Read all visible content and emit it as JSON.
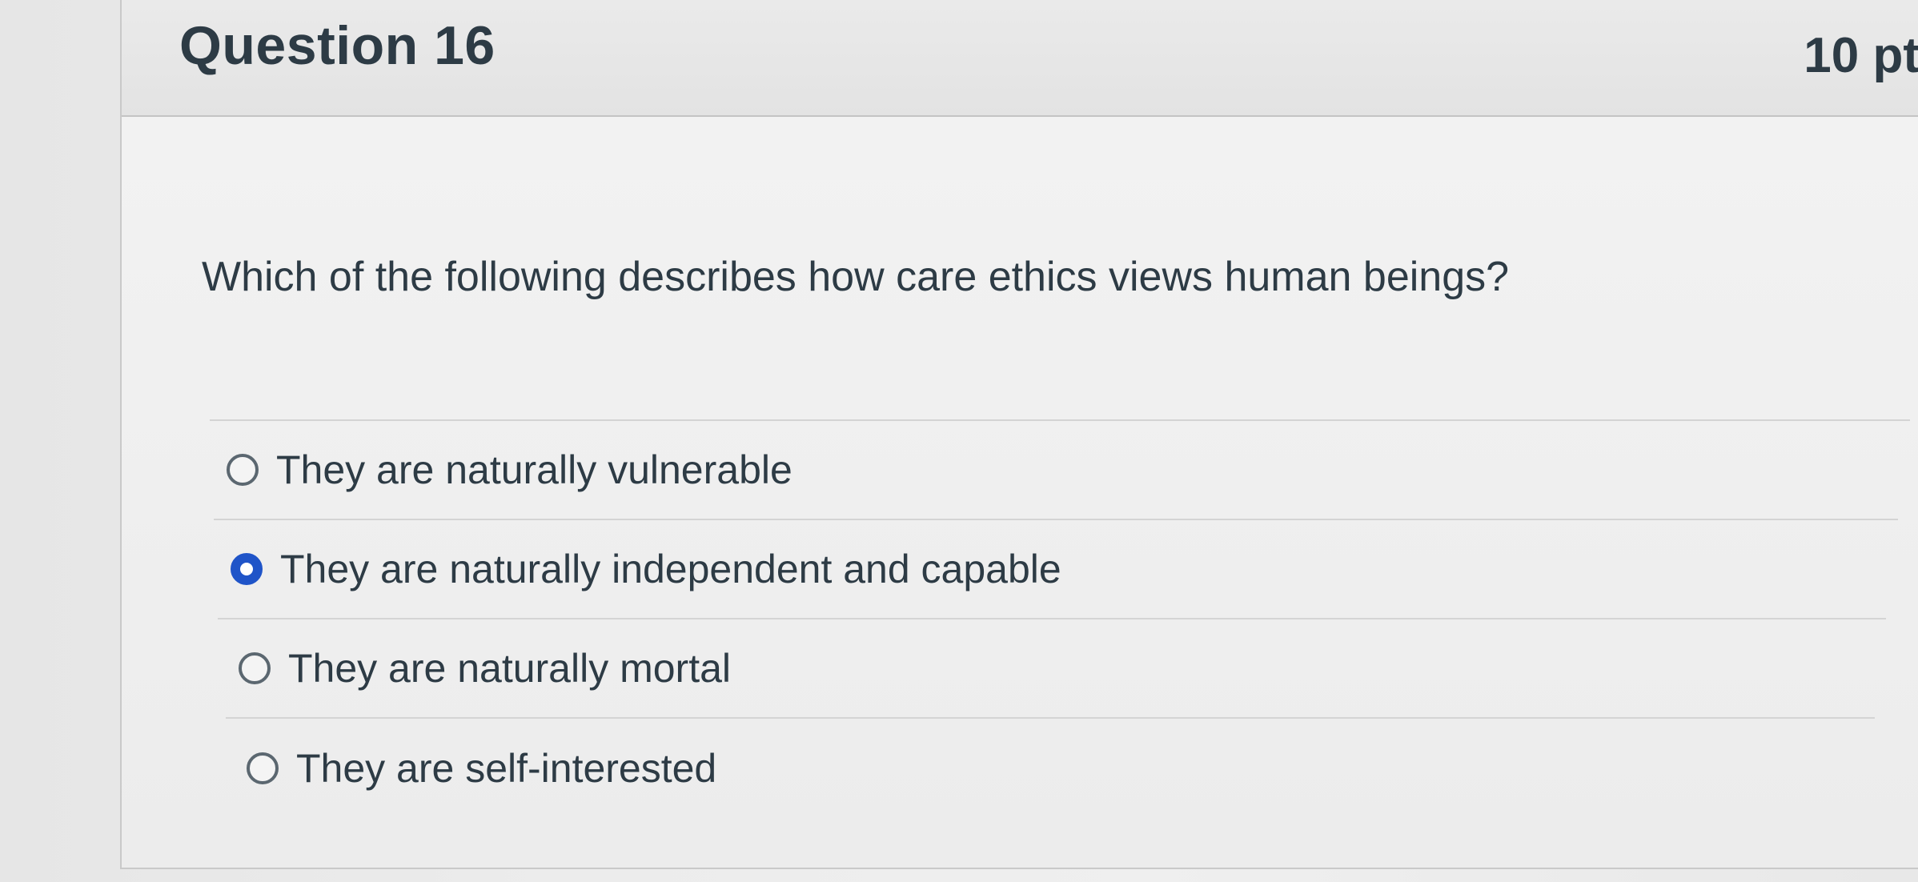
{
  "question": {
    "title": "Question 16",
    "points": "10 pt",
    "text": "Which of the following describes how care ethics views  human beings?",
    "answers": [
      {
        "label": "They are naturally vulnerable",
        "selected": false
      },
      {
        "label": "They are naturally independent and capable",
        "selected": true
      },
      {
        "label": "They are naturally mortal",
        "selected": false
      },
      {
        "label": "They are self-interested",
        "selected": false
      }
    ]
  },
  "colors": {
    "text": "#2d3b45",
    "selected_radio": "#1f54c8",
    "divider": "#d4d4d4"
  }
}
